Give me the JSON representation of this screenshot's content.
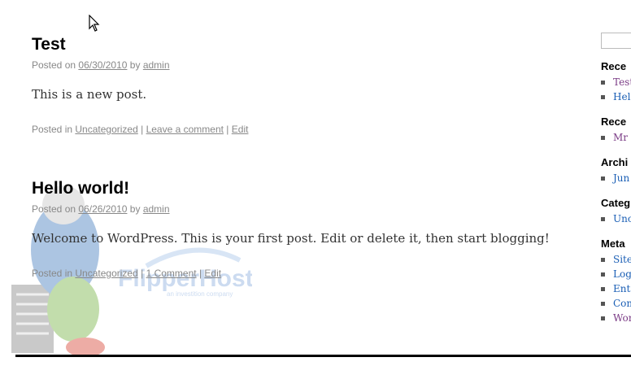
{
  "posts": [
    {
      "title": "Test",
      "posted_on_label": "Posted on",
      "date": "06/30/2010",
      "by_label": "by",
      "author": "admin",
      "content": "This is a new post.",
      "posted_in_label": "Posted in",
      "category": "Uncategorized",
      "comment_link": "Leave a comment",
      "edit_link": "Edit"
    },
    {
      "title": "Hello world!",
      "posted_on_label": "Posted on",
      "date": "06/26/2010",
      "by_label": "by",
      "author": "admin",
      "content": "Welcome to WordPress. This is your first post. Edit or delete it, then start blogging!",
      "posted_in_label": "Posted in",
      "category": "Uncategorized",
      "comment_link": "1 Comment",
      "edit_link": "Edit"
    }
  ],
  "watermark": {
    "brand": "FlipperHost",
    "tagline": "an investition company"
  },
  "sidebar": {
    "search_value": "",
    "widgets": [
      {
        "title": "Rece",
        "items": [
          "Test",
          "Hel"
        ]
      },
      {
        "title": "Rece",
        "items": [
          "Mr"
        ]
      },
      {
        "title": "Archi",
        "items": [
          "Jun"
        ]
      },
      {
        "title": "Categ",
        "items": [
          "Unc"
        ]
      },
      {
        "title": "Meta",
        "items": [
          "Site",
          "Log",
          "Ent",
          "Com",
          "Wor"
        ]
      }
    ]
  },
  "colors": {
    "link_blue": "#1b5fb5",
    "link_purple": "#7b3c86",
    "meta_gray": "#888888"
  }
}
